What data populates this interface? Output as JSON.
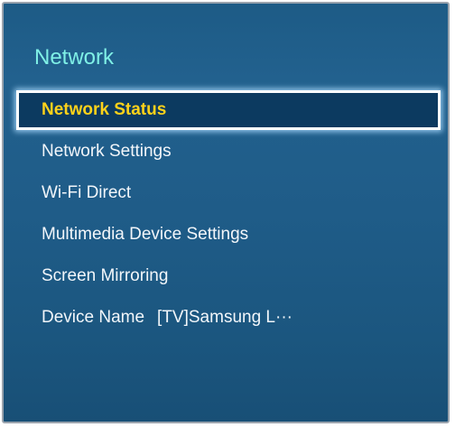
{
  "menu": {
    "title": "Network",
    "items": [
      {
        "label": "Network Status",
        "value": "",
        "selected": true
      },
      {
        "label": "Network Settings",
        "value": "",
        "selected": false
      },
      {
        "label": "Wi-Fi Direct",
        "value": "",
        "selected": false
      },
      {
        "label": "Multimedia Device Settings",
        "value": "",
        "selected": false
      },
      {
        "label": "Screen Mirroring",
        "value": "",
        "selected": false
      },
      {
        "label": "Device Name",
        "value": "[TV]Samsung L···",
        "selected": false
      }
    ]
  },
  "colors": {
    "title": "#7ff0e6",
    "item_text": "#f2f6fa",
    "selected_text": "#ffd21a",
    "selected_background": "#0c3a60",
    "panel_background": "#1f5c88"
  }
}
